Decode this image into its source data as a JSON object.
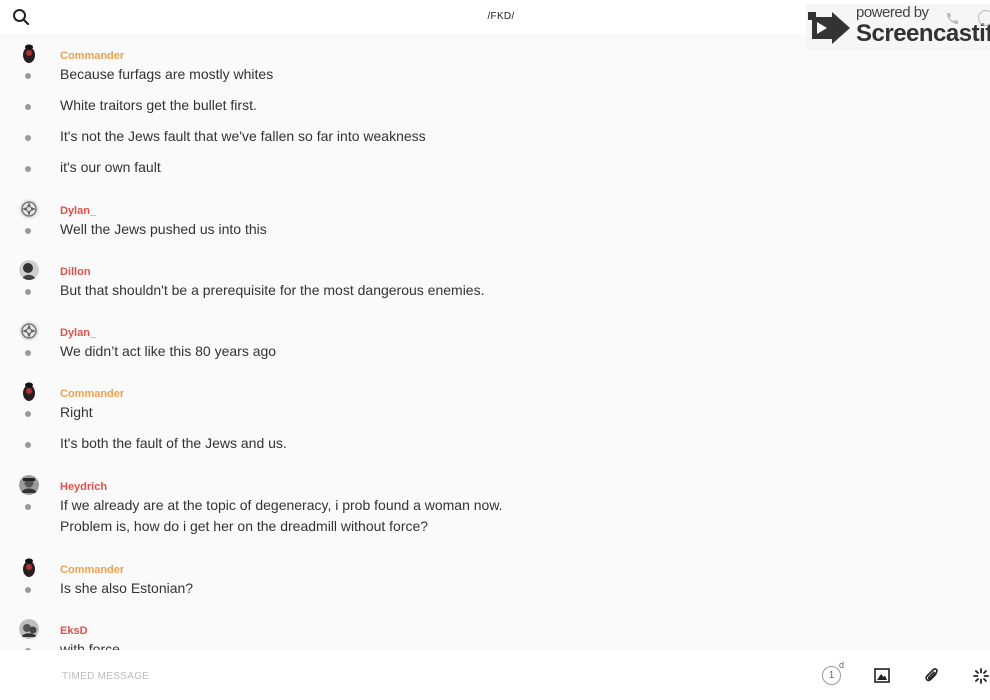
{
  "header": {
    "channel": "/FKD/",
    "search_icon": "search-icon"
  },
  "watermark": {
    "line1": "powered by",
    "line2": "Screencastify",
    "icons": [
      "phone-icon",
      "info-icon"
    ]
  },
  "colors": {
    "commander": "#f0a04b",
    "red_user": "#e0504a",
    "dot": "#9a9a9a",
    "background": "#fafafa"
  },
  "messages": [
    {
      "author": "Commander",
      "color": "#f0a04b",
      "avatar": "commander-avatar",
      "lines": [
        "Because furfags are mostly whites",
        "White traitors get the bullet first.",
        "It's not the Jews fault that we've fallen so far into weakness",
        "it's our own fault"
      ]
    },
    {
      "author": "Dylan_",
      "color": "#e0504a",
      "avatar": "dylan-avatar",
      "lines": [
        "Well the Jews pushed us into this"
      ]
    },
    {
      "author": "Dillon",
      "color": "#e0504a",
      "avatar": "dillon-avatar",
      "lines": [
        "But that shouldn't be a prerequisite for the most dangerous enemies."
      ]
    },
    {
      "author": "Dylan_",
      "color": "#e0504a",
      "avatar": "dylan-avatar",
      "lines": [
        "We didn’t act like this 80 years ago"
      ]
    },
    {
      "author": "Commander",
      "color": "#f0a04b",
      "avatar": "commander-avatar",
      "lines": [
        "Right",
        "It's both the fault of the Jews and us."
      ]
    },
    {
      "author": "Heydrich",
      "color": "#e0504a",
      "avatar": "heydrich-avatar",
      "lines": [
        "If we already are at the topic of degeneracy, i prob found a woman now.\nProblem is, how do i get her on the dreadmill without force?"
      ]
    },
    {
      "author": "Commander",
      "color": "#f0a04b",
      "avatar": "commander-avatar",
      "lines": [
        "Is she also Estonian?"
      ]
    },
    {
      "author": "EksD",
      "color": "#e0504a",
      "avatar": "eksd-avatar",
      "lines": [
        "with force"
      ]
    }
  ],
  "composer": {
    "placeholder": "TIMED MESSAGE",
    "timer_value": "1",
    "timer_unit": "d",
    "buttons": [
      "timer-icon",
      "image-icon",
      "paperclip-icon",
      "sparkle-icon"
    ]
  }
}
